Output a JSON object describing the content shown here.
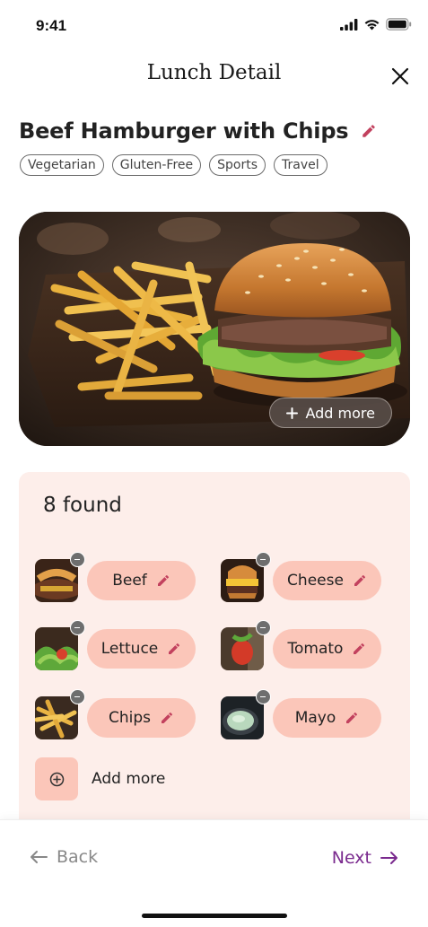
{
  "status": {
    "time": "9:41"
  },
  "header": {
    "title": "Lunch Detail"
  },
  "meal": {
    "title": "Beef Hamburger with Chips",
    "tags": [
      "Vegetarian",
      "Gluten-Free",
      "Sports",
      "Travel"
    ]
  },
  "photo": {
    "add_more_label": "Add more"
  },
  "found": {
    "count_label": "8 found",
    "ingredients": [
      {
        "name": "Beef"
      },
      {
        "name": "Cheese"
      },
      {
        "name": "Lettuce"
      },
      {
        "name": "Tomato"
      },
      {
        "name": "Chips"
      },
      {
        "name": "Mayo"
      }
    ],
    "add_more_label": "Add more"
  },
  "nav": {
    "back_label": "Back",
    "next_label": "Next"
  },
  "colors": {
    "accent": "#7a2a8e",
    "chip": "#fbc6b9",
    "panel": "#fdeeea",
    "edit": "#c2415e"
  }
}
